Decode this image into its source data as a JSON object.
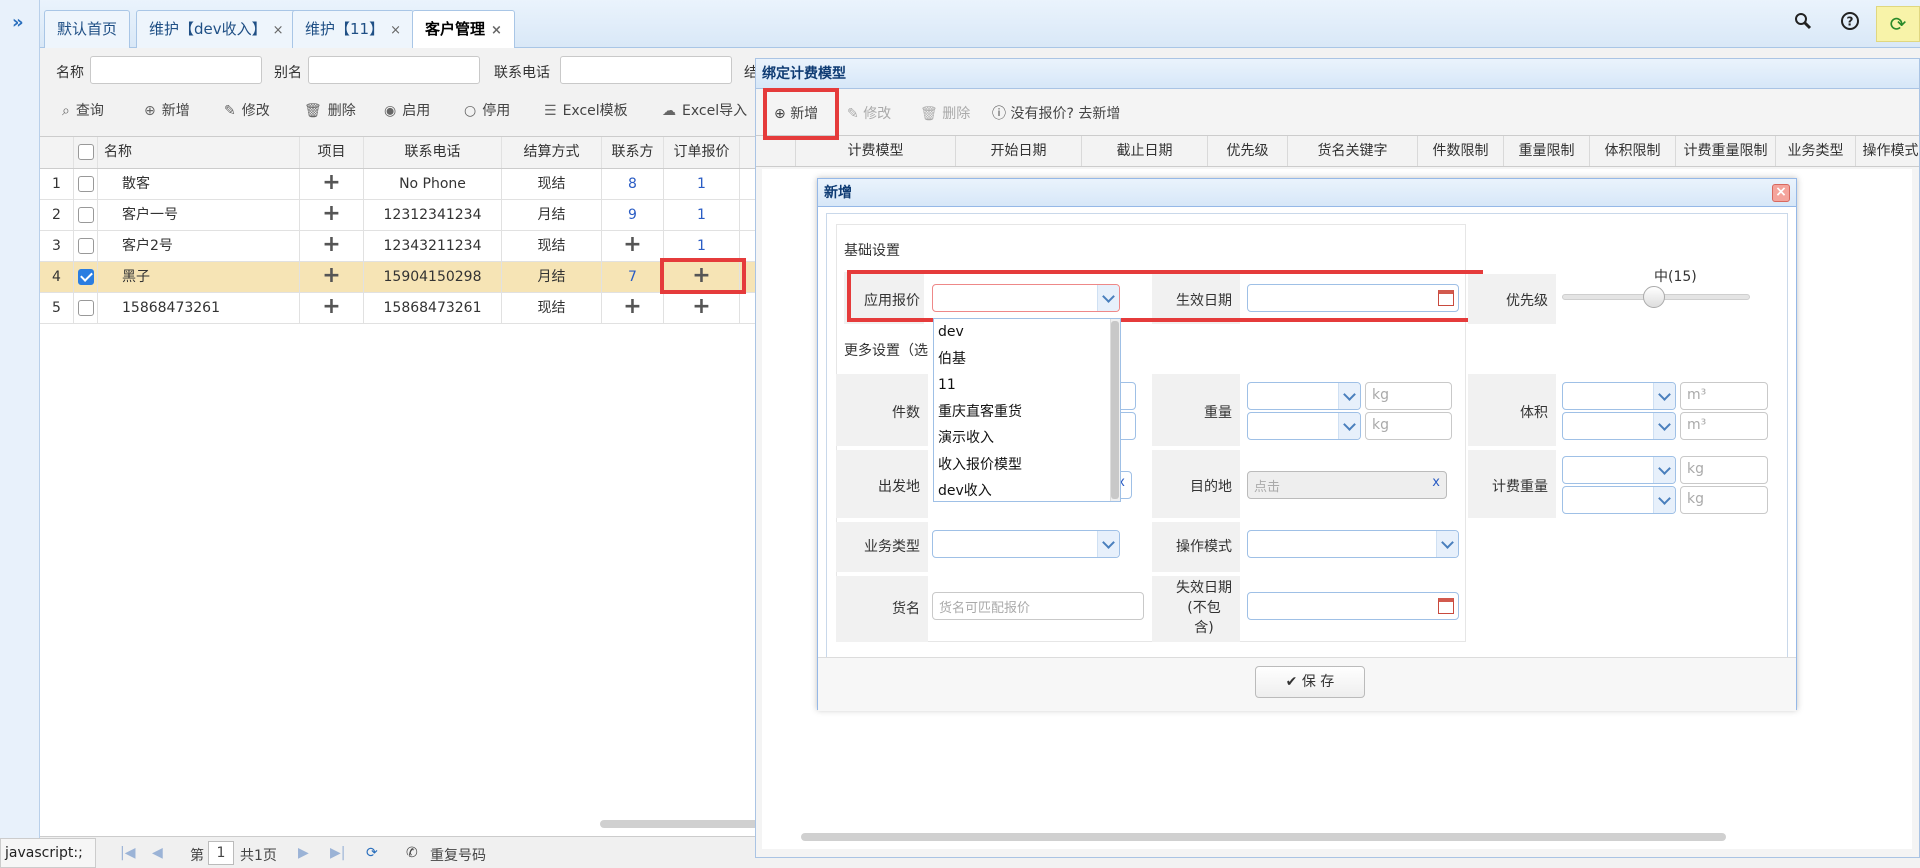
{
  "app": {
    "status_text": "javascript:;"
  },
  "tabs": [
    {
      "label": "默认首页",
      "closable": false
    },
    {
      "label": "维护【dev收入】",
      "closable": true
    },
    {
      "label": "维护【11】",
      "closable": true
    },
    {
      "label": "客户管理",
      "closable": true,
      "active": true
    }
  ],
  "top_icons": [
    "search-icon",
    "help-icon",
    "refresh-icon"
  ],
  "filter": {
    "name_label": "名称",
    "alias_label": "别名",
    "phone_label": "联系电话",
    "truncated_label": "结"
  },
  "toolbar": [
    {
      "label": "查询",
      "icon": "search-icon"
    },
    {
      "label": "新增",
      "icon": "plus-circle-icon"
    },
    {
      "label": "修改",
      "icon": "edit-icon"
    },
    {
      "label": "删除",
      "icon": "trash-icon"
    },
    {
      "label": "启用",
      "icon": "radio-on-icon"
    },
    {
      "label": "停用",
      "icon": "radio-off-icon"
    },
    {
      "label": "Excel模板",
      "icon": "list-icon"
    },
    {
      "label": "Excel导入",
      "icon": "upload-icon"
    }
  ],
  "grid": {
    "columns": [
      "名称",
      "项目",
      "联系电话",
      "结算方式",
      "联系方",
      "订单报价"
    ],
    "rows": [
      {
        "no": "1",
        "name": "散客",
        "phone": "No Phone",
        "settle": "现结",
        "contact": "8",
        "quote": "1",
        "checked": false
      },
      {
        "no": "2",
        "name": "客户一号",
        "phone": "12312341234",
        "settle": "月结",
        "contact": "9",
        "quote": "1",
        "checked": false
      },
      {
        "no": "3",
        "name": "客户2号",
        "phone": "12343211234",
        "settle": "现结",
        "contact": "+",
        "quote": "1",
        "checked": false
      },
      {
        "no": "4",
        "name": "黑子",
        "phone": "15904150298",
        "settle": "月结",
        "contact": "7",
        "quote": "+",
        "checked": true
      },
      {
        "no": "5",
        "name": "15868473261",
        "phone": "15868473261",
        "settle": "现结",
        "contact": "+",
        "quote": "+",
        "checked": false
      }
    ]
  },
  "pager": {
    "page_prefix": "第",
    "page_value": "1",
    "page_suffix": "共1页",
    "duplicate_label": "重复号码"
  },
  "panel": {
    "title": "绑定计费模型",
    "toolbar": {
      "add": "新增",
      "edit": "修改",
      "delete": "删除",
      "no_quote": "没有报价? 去新增"
    },
    "columns": [
      "计费模型",
      "开始日期",
      "截止日期",
      "优先级",
      "货名关键字",
      "件数限制",
      "重量限制",
      "体积限制",
      "计费重量限制",
      "业务类型",
      "操作模式"
    ]
  },
  "modal": {
    "title": "新增",
    "basic_section": "基础设置",
    "more_section": "更多设置（选",
    "apply_quote_label": "应用报价",
    "effective_date_label": "生效日期",
    "priority_label": "优先级",
    "priority_value": "中(15)",
    "count_label": "件数",
    "weight_label": "重量",
    "volume_label": "体积",
    "origin_label": "出发地",
    "destination_label": "目的地",
    "destination_placeholder": "点击",
    "charge_weight_label": "计费重量",
    "business_type_label": "业务类型",
    "operation_mode_label": "操作模式",
    "goods_label": "货名",
    "goods_placeholder": "货名可匹配报价",
    "expire_label_1": "失效日期",
    "expire_label_2": "(不包",
    "expire_label_3": "含)",
    "unit_kg": "kg",
    "unit_m3": "m³",
    "clear_mark": "x",
    "save_label": "保 存",
    "dropdown_options": [
      "dev",
      "伯基",
      "11",
      "重庆直客重货",
      "演示收入",
      "收入报价模型",
      "dev收入"
    ]
  }
}
